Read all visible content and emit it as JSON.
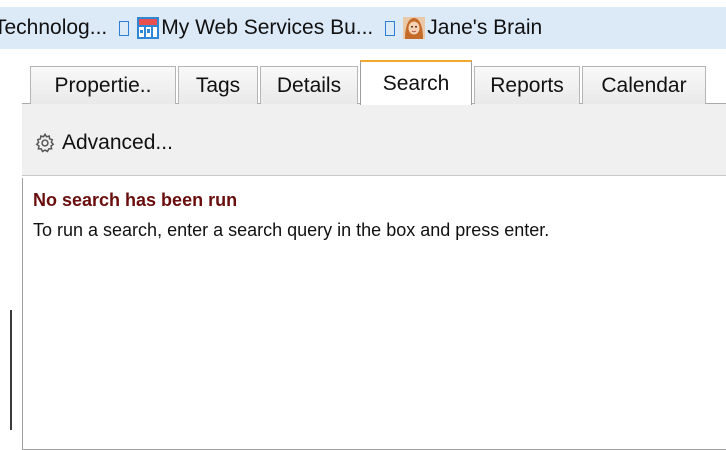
{
  "breadcrumb": {
    "items": [
      {
        "label": "Technolog...",
        "icon": "none"
      },
      {
        "label": "My Web Services Bu...",
        "icon": "web-services-thumbnail-icon"
      },
      {
        "label": "Jane's Brain",
        "icon": "jane-avatar-icon"
      }
    ],
    "separator_color": "#2d7fd6",
    "background": "#dce9f7"
  },
  "tabs": [
    {
      "label": "Propertie..",
      "active": false
    },
    {
      "label": "Tags",
      "active": false
    },
    {
      "label": "Details",
      "active": false
    },
    {
      "label": "Search",
      "active": true
    },
    {
      "label": "Reports",
      "active": false
    },
    {
      "label": "Calendar",
      "active": false
    }
  ],
  "toolbar": {
    "advanced_label": "Advanced...",
    "advanced_icon": "gear-icon"
  },
  "results": {
    "title": "No search has been run",
    "hint": "To run a search, enter a search query in the box and press enter.",
    "title_color": "#6a0d0d"
  },
  "colors": {
    "active_tab_accent": "#f0a830",
    "toolbar_bg": "#f0f0f0"
  }
}
